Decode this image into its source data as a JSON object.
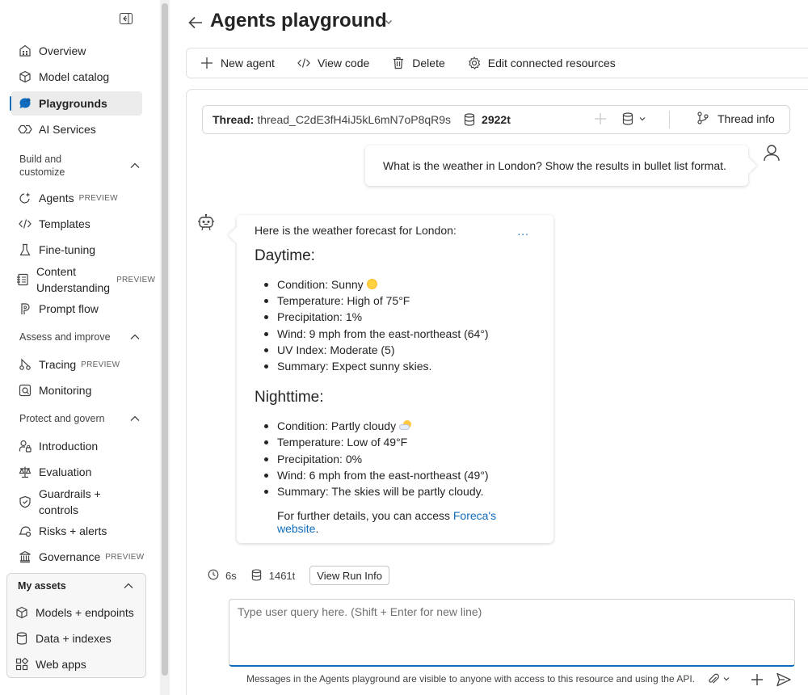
{
  "sidebar": {
    "collapse_icon": "collapse-panel-icon",
    "items": {
      "overview": {
        "label": "Overview",
        "icon": "grid-icon"
      },
      "model_catalog": {
        "label": "Model catalog",
        "icon": "cube-icon"
      },
      "playgrounds": {
        "label": "Playgrounds",
        "icon": "chat-icon"
      },
      "ai_services": {
        "label": "AI Services",
        "icon": "link-icon"
      },
      "agents": {
        "label": "Agents",
        "badge": "PREVIEW",
        "icon": "sparkle-icon"
      },
      "templates": {
        "label": "Templates",
        "icon": "code-icon"
      },
      "fine_tuning": {
        "label": "Fine-tuning",
        "icon": "flask-icon"
      },
      "content_understanding": {
        "label_line1": "Content",
        "label_line2": "Understanding",
        "badge": "PREVIEW",
        "icon": "document-icon"
      },
      "prompt_flow": {
        "label": "Prompt flow",
        "icon": "flow-icon"
      },
      "tracing": {
        "label": "Tracing",
        "badge": "PREVIEW",
        "icon": "trace-icon"
      },
      "monitoring": {
        "label": "Monitoring",
        "icon": "monitor-icon"
      },
      "introduction": {
        "label": "Introduction",
        "icon": "person-lock-icon"
      },
      "evaluation": {
        "label": "Evaluation",
        "icon": "scale-icon"
      },
      "guardrails": {
        "label_line1": "Guardrails +",
        "label_line2": "controls",
        "icon": "shield-icon"
      },
      "risks": {
        "label": "Risks + alerts",
        "icon": "alert-icon"
      },
      "governance": {
        "label": "Governance",
        "badge": "PREVIEW",
        "icon": "building-icon"
      },
      "models_endpoints": {
        "label": "Models + endpoints",
        "icon": "cube-icon"
      },
      "data_indexes": {
        "label": "Data + indexes",
        "icon": "database-icon"
      },
      "web_apps": {
        "label": "Web apps",
        "icon": "apps-icon"
      }
    },
    "sections": {
      "build": {
        "line1": "Build and",
        "line2": "customize"
      },
      "assess": "Assess and improve",
      "protect": "Protect and govern",
      "assets": "My assets"
    }
  },
  "header": {
    "title": "Agents playground"
  },
  "toolbar": {
    "new_agent": "New agent",
    "view_code": "View code",
    "delete": "Delete",
    "edit_resources": "Edit connected resources"
  },
  "thread": {
    "label": "Thread:",
    "id": "thread_C2dE3fH4iJ5kL6mN7oP8qR9s",
    "tokens": "2922t",
    "info": "Thread info"
  },
  "messages": {
    "user": "What is the weather in London? Show the results in bullet list format.",
    "bot": {
      "intro": "Here is the weather forecast for London:",
      "more": "...",
      "daytime_heading": "Daytime:",
      "daytime": [
        "Condition: Sunny",
        "Temperature: High of 75°F",
        "Precipitation: 1%",
        "Wind: 9 mph from the east-northeast (64°)",
        "UV Index: Moderate (5)",
        "Summary: Expect sunny skies."
      ],
      "nighttime_heading": "Nighttime:",
      "nighttime": [
        "Condition: Partly cloudy",
        "Temperature: Low of 49°F",
        "Precipitation: 0%",
        "Wind: 6 mph from the east-northeast (49°)",
        "Summary: The skies will be partly cloudy."
      ],
      "further_prefix": "For further details, you can access ",
      "link_text": "Foreca's website",
      "further_suffix": "."
    }
  },
  "run": {
    "time": "6s",
    "tokens": "1461t",
    "button": "View Run Info"
  },
  "composer": {
    "placeholder": "Type user query here. (Shift + Enter for new line)",
    "note": "Messages in the Agents playground are visible to anyone with access to this resource and using the API."
  },
  "colors": {
    "accent": "#0f6cbd",
    "text": "#242424"
  }
}
